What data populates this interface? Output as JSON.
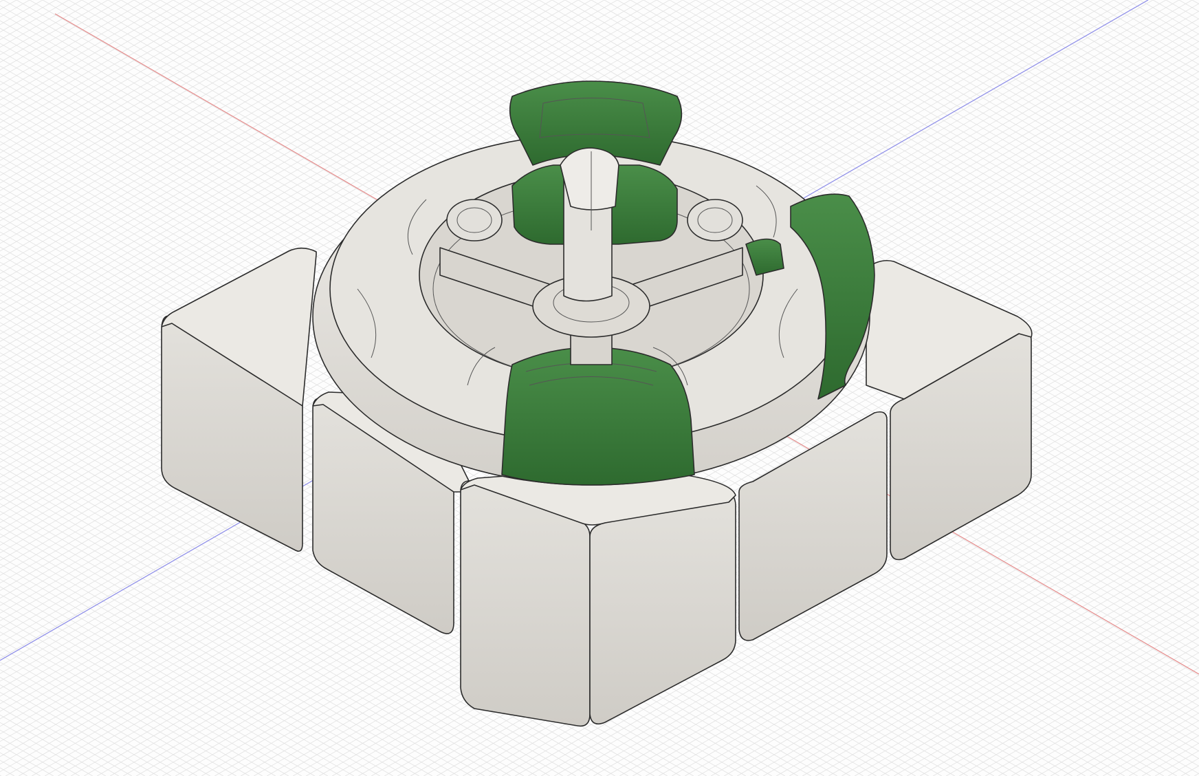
{
  "viewport": {
    "name": "cad-3d-viewport",
    "background_color": "#fdfdfd",
    "grid_color": "#e2e2e2",
    "x_axis_color": "#e07070",
    "y_axis_color": "#7a7ae0"
  },
  "model": {
    "part_color_gray": "#dcdad5",
    "part_color_gray_shade": "#cbc8c2",
    "part_color_green": "#3f7f3f",
    "part_color_green_shade": "#2f6a30",
    "edge_color": "#2b2b2b"
  }
}
